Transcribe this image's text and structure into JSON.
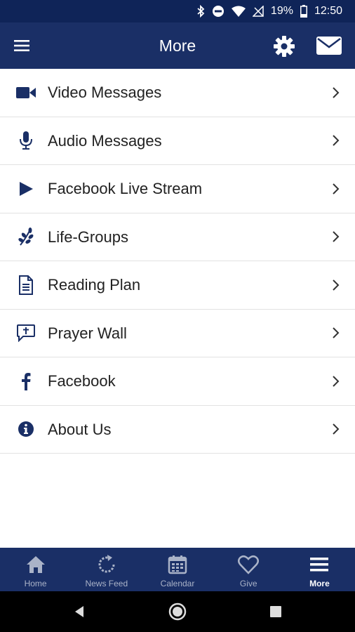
{
  "status_bar": {
    "battery": "19%",
    "time": "12:50",
    "icons": [
      "bluetooth-icon",
      "do-not-disturb-icon",
      "wifi-icon",
      "no-signal-icon",
      "battery-icon"
    ]
  },
  "app_bar": {
    "title": "More",
    "icons": [
      "hamburger-menu-icon",
      "gear-icon",
      "mail-icon"
    ]
  },
  "menu": {
    "items": [
      {
        "label": "Video Messages",
        "icon": "video-camera-icon"
      },
      {
        "label": "Audio Messages",
        "icon": "microphone-icon"
      },
      {
        "label": "Facebook Live Stream",
        "icon": "play-icon"
      },
      {
        "label": "Life-Groups",
        "icon": "leaf-branch-icon"
      },
      {
        "label": "Reading Plan",
        "icon": "document-icon"
      },
      {
        "label": "Prayer Wall",
        "icon": "cross-speech-bubble-icon"
      },
      {
        "label": "Facebook",
        "icon": "facebook-icon"
      },
      {
        "label": "About Us",
        "icon": "info-icon"
      }
    ]
  },
  "tabs": [
    {
      "label": "Home",
      "icon": "home-icon",
      "active": false
    },
    {
      "label": "News Feed",
      "icon": "refresh-icon",
      "active": false
    },
    {
      "label": "Calendar",
      "icon": "calendar-icon",
      "active": false
    },
    {
      "label": "Give",
      "icon": "heart-icon",
      "active": false
    },
    {
      "label": "More",
      "icon": "hamburger-icon",
      "active": true
    }
  ],
  "colors": {
    "primary": "#1a2f66",
    "status_bar": "#0f2458",
    "icon": "#1a2f66",
    "text": "#222222",
    "inactive_tab": "#aab3c8"
  }
}
